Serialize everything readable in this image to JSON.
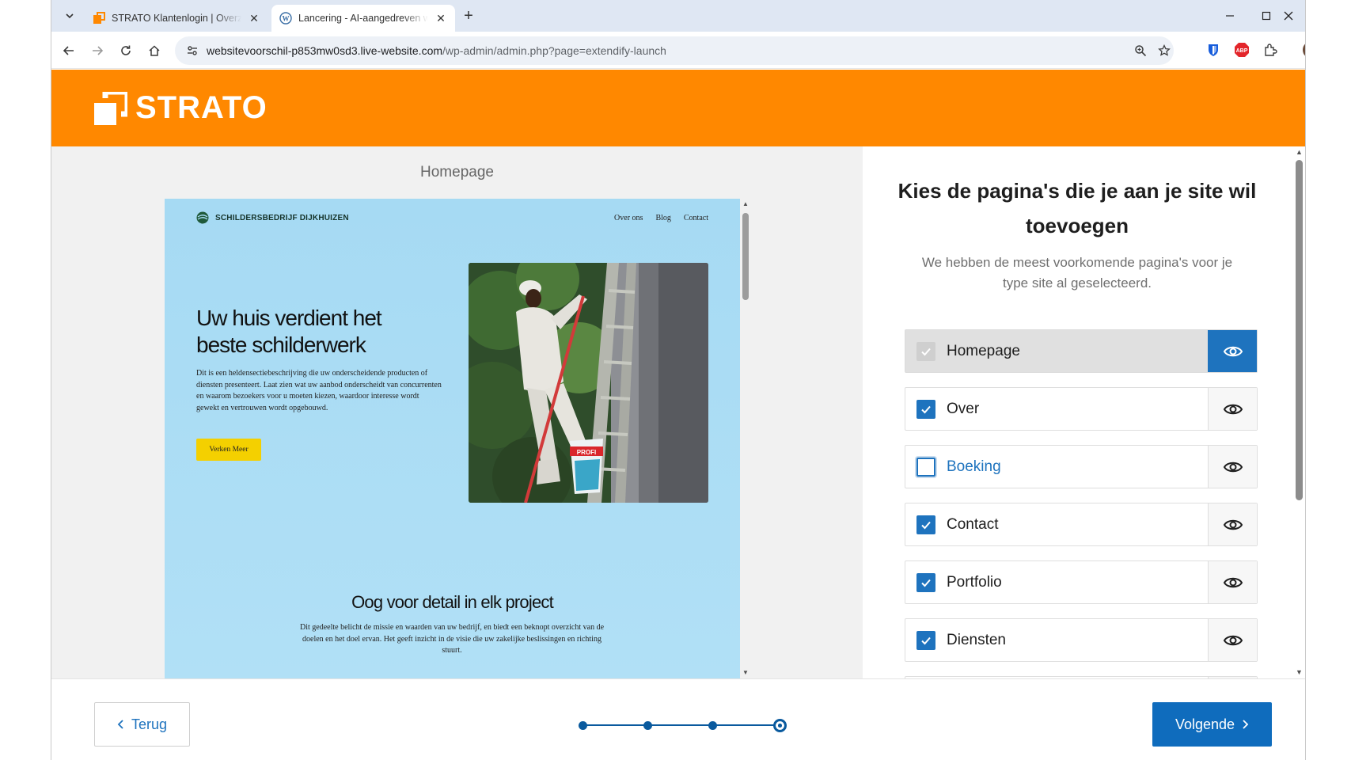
{
  "browser": {
    "tabs": [
      {
        "title": "STRATO Klantenlogin | Overzicht",
        "active": false,
        "favicon": "strato-icon"
      },
      {
        "title": "Lancering - AI-aangedreven webs",
        "active": true,
        "favicon": "wordpress-icon"
      }
    ],
    "url_host": "websitevoorschil-p853mw0sd3.live-website.com",
    "url_path": "/wp-admin/admin.php?page=extendify-launch",
    "extensions": [
      "bitwarden-icon",
      "adblock-plus-icon",
      "extensions-puzzle-icon",
      "profile-avatar"
    ]
  },
  "brand": {
    "name": "STRATO",
    "color": "#ff8800"
  },
  "preview": {
    "title": "Homepage",
    "site": {
      "logo_text": "SCHILDERSBEDRIJF DIJKHUIZEN",
      "nav": [
        "Over ons",
        "Blog",
        "Contact"
      ],
      "hero_heading": "Uw huis verdient het beste schilderwerk",
      "hero_text": "Dit is een heldensectiebeschrijving die uw onderscheidende producten of diensten presenteert. Laat zien wat uw aanbod onderscheidt van concurrenten en waarom bezoekers voor u moeten kiezen, waardoor interesse wordt gewekt en vertrouwen wordt opgebouwd.",
      "hero_button": "Verken Meer",
      "section_heading": "Oog voor detail in elk project",
      "section_text": "Dit gedeelte belicht de missie en waarden van uw bedrijf, en biedt een beknopt overzicht van de doelen en het doel ervan. Het geeft inzicht in de visie die uw zakelijke beslissingen en richting stuurt.",
      "bucket_label": "PROFI"
    }
  },
  "panel": {
    "heading": "Kies de pagina's die je aan je site wil toevoegen",
    "subheading": "We hebben de meest voorkomende pagina's voor je type site al geselecteerd.",
    "pages": [
      {
        "label": "Homepage",
        "state": "locked",
        "previewing": true
      },
      {
        "label": "Over",
        "state": "checked",
        "previewing": false
      },
      {
        "label": "Boeking",
        "state": "unchecked",
        "previewing": false
      },
      {
        "label": "Contact",
        "state": "checked",
        "previewing": false
      },
      {
        "label": "Portfolio",
        "state": "checked",
        "previewing": false
      },
      {
        "label": "Diensten",
        "state": "checked",
        "previewing": false
      }
    ]
  },
  "footer": {
    "back_label": "Terug",
    "next_label": "Volgende",
    "steps_total": 4,
    "current_step": 4,
    "accent": "#0f6cbd"
  }
}
